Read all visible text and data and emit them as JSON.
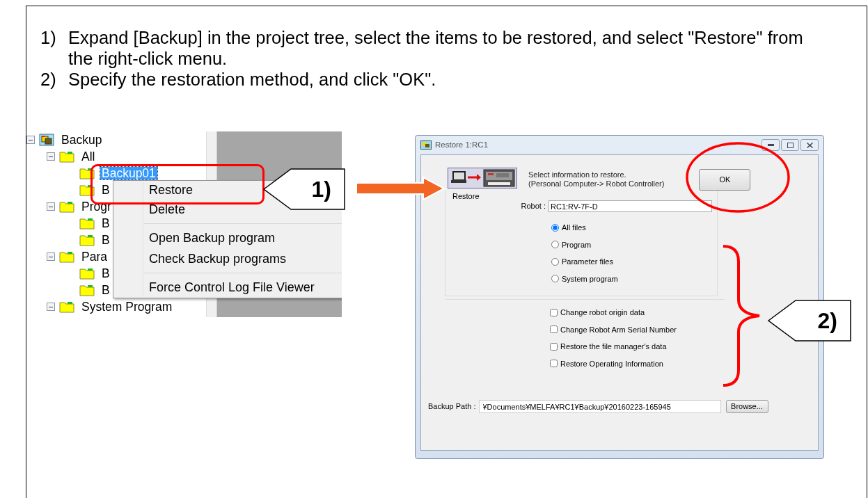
{
  "instructions": [
    {
      "number": "1)",
      "text": "Expand [Backup] in the project tree, select the items to be restored, and select \"Restore\" from the right-click menu."
    },
    {
      "number": "2)",
      "text": "Specify the restoration method, and click \"OK\"."
    }
  ],
  "tree": {
    "items": [
      {
        "label": "Backup",
        "expanded": true,
        "selected": false,
        "children": [
          {
            "label": "All",
            "expanded": true,
            "selected": false,
            "children": [
              {
                "label": "Backup01",
                "selected": true
              },
              {
                "label": "B",
                "selected": false
              }
            ]
          },
          {
            "label": "Progr",
            "expanded": true,
            "selected": false,
            "children": [
              {
                "label": "B",
                "selected": false
              },
              {
                "label": "B",
                "selected": false
              }
            ]
          },
          {
            "label": "Para",
            "expanded": true,
            "selected": false,
            "children": [
              {
                "label": "B",
                "selected": false
              },
              {
                "label": "B",
                "selected": false
              }
            ]
          },
          {
            "label": "System Program",
            "expanded": true,
            "selected": false
          }
        ]
      }
    ]
  },
  "context_menu": {
    "groups": [
      [
        "Restore",
        "Delete"
      ],
      [
        "Open Backup program",
        "Check Backup programs"
      ],
      [
        "Force Control Log File Viewer"
      ]
    ]
  },
  "callouts": [
    {
      "label": "1)"
    },
    {
      "label": "2)"
    }
  ],
  "dialog": {
    "title": "Restore 1:RC1",
    "message": [
      "Select information to restore.",
      "(Personal Computer-> Robot Controller)"
    ],
    "ok_button": "OK",
    "group_title": "Restore",
    "robot_label": "Robot :",
    "robot_value": "RC1:RV-7F-D",
    "targets": [
      {
        "label": "All files",
        "selected": true
      },
      {
        "label": "Program",
        "selected": false
      },
      {
        "label": "Parameter files",
        "selected": false
      },
      {
        "label": "System program",
        "selected": false
      }
    ],
    "options": [
      {
        "label": "Change robot origin data",
        "checked": false
      },
      {
        "label": "Change Robot Arm Serial Number",
        "checked": false
      },
      {
        "label": "Restore the file manager's data",
        "checked": false
      },
      {
        "label": "Restore Operating Information",
        "checked": false
      }
    ],
    "backup_path_label": "Backup Path :",
    "backup_path": "¥Documents¥MELFA¥RC1¥Backup¥20160223-165945",
    "browse_button": "Browse..."
  }
}
